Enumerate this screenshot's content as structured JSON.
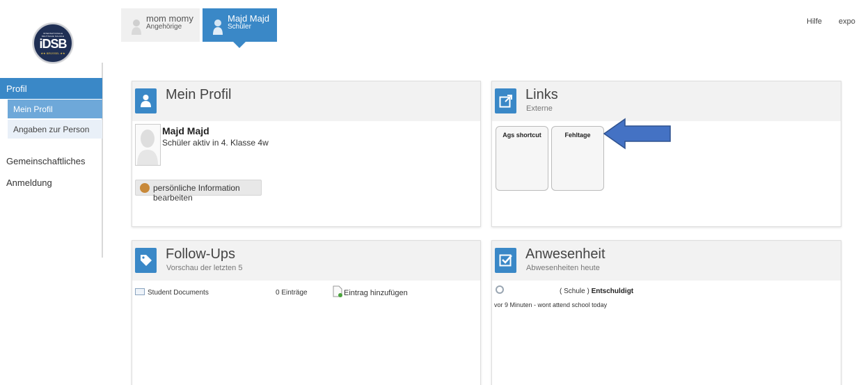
{
  "logo": {
    "line1": "INTERNATIONALE",
    "line2": "DEUTSCHE SCHULE",
    "main": "iDSB",
    "tagline": "★★ BRÜSSEL ★★"
  },
  "tabs": [
    {
      "name": "mom momy",
      "role": "Angehörige"
    },
    {
      "name": "Majd Majd",
      "role": "Schüler"
    }
  ],
  "header_links": {
    "help": "Hilfe",
    "export": "expo"
  },
  "sidebar": {
    "section": "Profil",
    "items": [
      {
        "label": "Mein Profil"
      },
      {
        "label": "Angaben zur Person"
      }
    ],
    "links": [
      {
        "label": "Gemeinschaftliches"
      },
      {
        "label": "Anmeldung"
      }
    ]
  },
  "profile_panel": {
    "title": "Mein Profil",
    "name": "Majd Majd",
    "status": "Schüler aktiv in 4. Klasse 4w",
    "edit_button": "persönliche Information bearbeiten"
  },
  "links_panel": {
    "title": "Links",
    "subtitle": "Externe",
    "tiles": [
      {
        "label": "Ags shortcut"
      },
      {
        "label": "Fehltage"
      }
    ]
  },
  "followups_panel": {
    "title": "Follow-Ups",
    "subtitle": "Vorschau der letzten 5",
    "row": {
      "label": "Student Documents",
      "count": "0 Einträge",
      "add": "Eintrag hinzufügen"
    }
  },
  "attendance_panel": {
    "title": "Anwesenheit",
    "subtitle": "Abwesenheiten heute",
    "place": "( Schule )",
    "status": "Entschuldigt",
    "detail": "vor 9 Minuten - wont attend school today"
  },
  "colors": {
    "accent": "#3a88c7",
    "accent_light": "#6ea8d9",
    "annotation_arrow": "#4472c4"
  }
}
